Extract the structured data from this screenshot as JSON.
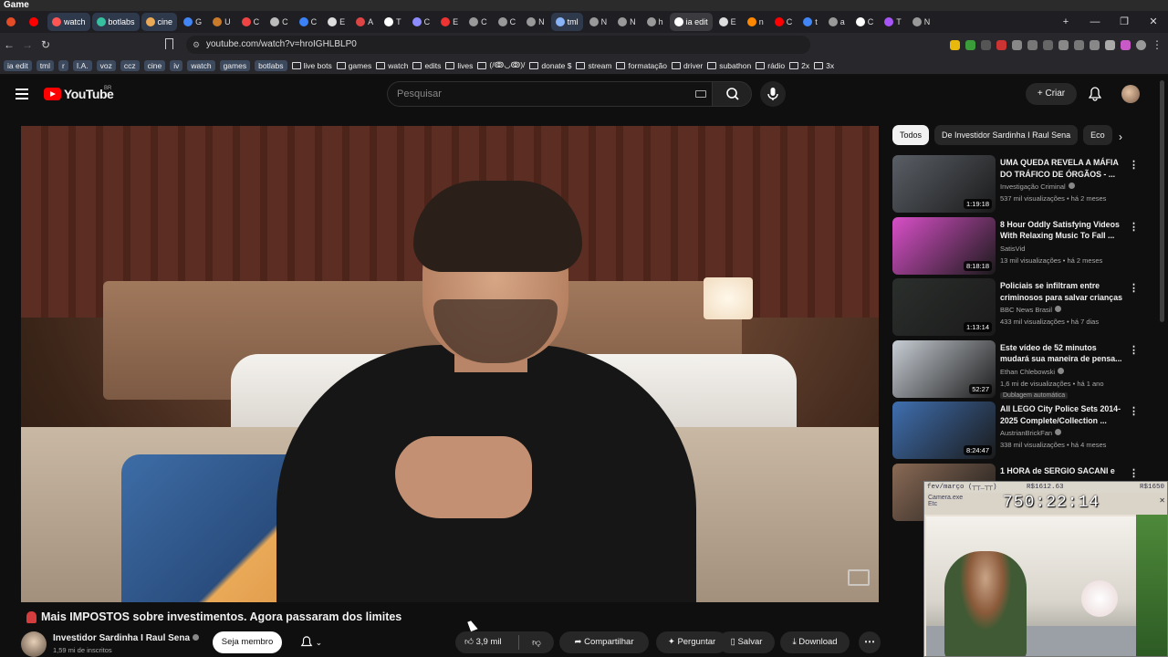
{
  "window": {
    "title": "Game"
  },
  "tabs": [
    {
      "label": "",
      "color": "#e34c26",
      "named": false
    },
    {
      "label": "",
      "color": "#ff0000",
      "named": false
    },
    {
      "label": "watch",
      "color": "#ff5555",
      "named": true
    },
    {
      "label": "botlabs",
      "color": "#37c0a0",
      "named": true
    },
    {
      "label": "cine",
      "color": "#e9a957",
      "named": true
    },
    {
      "label": "G",
      "color": "#4285f4",
      "named": false
    },
    {
      "label": "U",
      "color": "#c97a2b",
      "named": false
    },
    {
      "label": "C",
      "color": "#ee4444",
      "named": false
    },
    {
      "label": "C",
      "color": "#bbbbbb",
      "named": false
    },
    {
      "label": "C",
      "color": "#3b82f6",
      "named": false
    },
    {
      "label": "E",
      "color": "#dddddd",
      "named": false
    },
    {
      "label": "A",
      "color": "#dd4444",
      "named": false
    },
    {
      "label": "T",
      "color": "#ffffff",
      "named": false
    },
    {
      "label": "C",
      "color": "#8c8cff",
      "named": false
    },
    {
      "label": "E",
      "color": "#ee3333",
      "named": false
    },
    {
      "label": "C",
      "color": "#999999",
      "named": false
    },
    {
      "label": "C",
      "color": "#999999",
      "named": false
    },
    {
      "label": "N",
      "color": "#999999",
      "named": false
    },
    {
      "label": "tml",
      "color": "#8ab4f8",
      "named": true
    },
    {
      "label": "N",
      "color": "#999999",
      "named": false
    },
    {
      "label": "N",
      "color": "#999999",
      "named": false
    },
    {
      "label": "h",
      "color": "#999999",
      "named": false
    },
    {
      "label": "ia edit",
      "color": "#ffffff",
      "named": true,
      "active": true
    },
    {
      "label": "E",
      "color": "#dddddd",
      "named": false
    },
    {
      "label": "n",
      "color": "#ff8800",
      "named": false
    },
    {
      "label": "C",
      "color": "#ff0000",
      "named": false
    },
    {
      "label": "t",
      "color": "#4285f4",
      "named": false
    },
    {
      "label": "a",
      "color": "#999999",
      "named": false
    },
    {
      "label": "C",
      "color": "#ffffff",
      "named": false
    },
    {
      "label": "T",
      "color": "#a855f7",
      "named": false
    },
    {
      "label": "N",
      "color": "#999999",
      "named": false
    }
  ],
  "window_controls": {
    "minimize": "—",
    "maximize": "❐",
    "close": "✕"
  },
  "address": {
    "url": "youtube.com/watch?v=hroIGHLBLP0"
  },
  "bookmarks": [
    {
      "label": "ia edit",
      "type": "tag"
    },
    {
      "label": "tml",
      "type": "tag"
    },
    {
      "label": "r",
      "type": "tag"
    },
    {
      "label": "I.A.",
      "type": "tag"
    },
    {
      "label": "voz",
      "type": "tag"
    },
    {
      "label": "ccz",
      "type": "tag"
    },
    {
      "label": "cine",
      "type": "tag"
    },
    {
      "label": "iv",
      "type": "tag"
    },
    {
      "label": "watch",
      "type": "tag"
    },
    {
      "label": "games",
      "type": "tag"
    },
    {
      "label": "botlabs",
      "type": "tag"
    },
    {
      "label": "live bots",
      "type": "folder"
    },
    {
      "label": "games",
      "type": "folder"
    },
    {
      "label": "watch",
      "type": "folder"
    },
    {
      "label": "edits",
      "type": "folder"
    },
    {
      "label": "lives",
      "type": "folder"
    },
    {
      "label": "(/ↂ◡ↂ)/",
      "type": "folder"
    },
    {
      "label": "donate $",
      "type": "folder"
    },
    {
      "label": "stream",
      "type": "folder"
    },
    {
      "label": "formatação",
      "type": "folder"
    },
    {
      "label": "driver",
      "type": "folder"
    },
    {
      "label": "subathon",
      "type": "folder"
    },
    {
      "label": "rádio",
      "type": "folder"
    },
    {
      "label": "2x",
      "type": "folder"
    },
    {
      "label": "3x",
      "type": "folder"
    }
  ],
  "youtube": {
    "logo": "YouTube",
    "region": "BR",
    "search_placeholder": "Pesquisar",
    "create_label": "Criar",
    "create_icon": "+"
  },
  "video": {
    "title": "Mais IMPOSTOS sobre investimentos. Agora passaram dos limites",
    "channel": "Investidor Sardinha I Raul Sena",
    "subscribers": "1,59 mi de inscritos",
    "member_button": "Seja membro",
    "likes": "3,9 mil",
    "share": "Compartilhar",
    "ask": "Perguntar",
    "save": "Salvar",
    "download": "Download"
  },
  "chips": [
    "Todos",
    "De Investidor Sardinha I Raul Sena",
    "Eco"
  ],
  "recommendations": [
    {
      "title": "UMA QUEDA REVELA A MÁFIA DO TRÁFICO DE ÓRGÃOS - ...",
      "channel": "Investigação Criminal",
      "meta": "537 mil visualizações • há 2 meses",
      "duration": "1:19:18",
      "verified": true,
      "thumb_color": "#5a5f66"
    },
    {
      "title": "8 Hour Oddly Satisfying Videos With Relaxing Music To Fall ...",
      "channel": "SatisVid",
      "meta": "13 mil visualizações • há 2 meses",
      "duration": "8:18:18",
      "verified": false,
      "thumb_color": "#d94fc8"
    },
    {
      "title": "Policiais se infiltram entre criminosos para salvar crianças",
      "channel": "BBC News Brasil",
      "meta": "433 mil visualizações • há 7 dias",
      "duration": "1:13:14",
      "verified": true,
      "thumb_color": "#2b2f2c"
    },
    {
      "title": "Este vídeo de 52 minutos mudará sua maneira de pensa...",
      "channel": "Ethan Chlebowski",
      "meta": "1,6 mi de visualizações • há 1 ano",
      "extra": "Dublagem automática",
      "duration": "52:27",
      "verified": true,
      "thumb_color": "#c7cdd4"
    },
    {
      "title": "All LEGO City Police Sets 2014-2025 Complete/Collection ...",
      "channel": "AustrianBrickFan",
      "meta": "338 mil visualizações • há 4 meses",
      "duration": "8:24:47",
      "verified": true,
      "thumb_color": "#3f6fb0"
    },
    {
      "title": "1 HORA de SERGIO SACANI e",
      "channel": "",
      "meta": "",
      "duration": "",
      "verified": false,
      "thumb_color": "#8a6a55"
    }
  ],
  "overlay": {
    "header_left": "fev/março (┬┬_┬┬)",
    "header_mid": "R$1612.63",
    "header_right": "R$1650",
    "camera_label": "Camera.exe",
    "camera_sub": "Etc",
    "timer": "750:22:14",
    "close": "✕"
  }
}
